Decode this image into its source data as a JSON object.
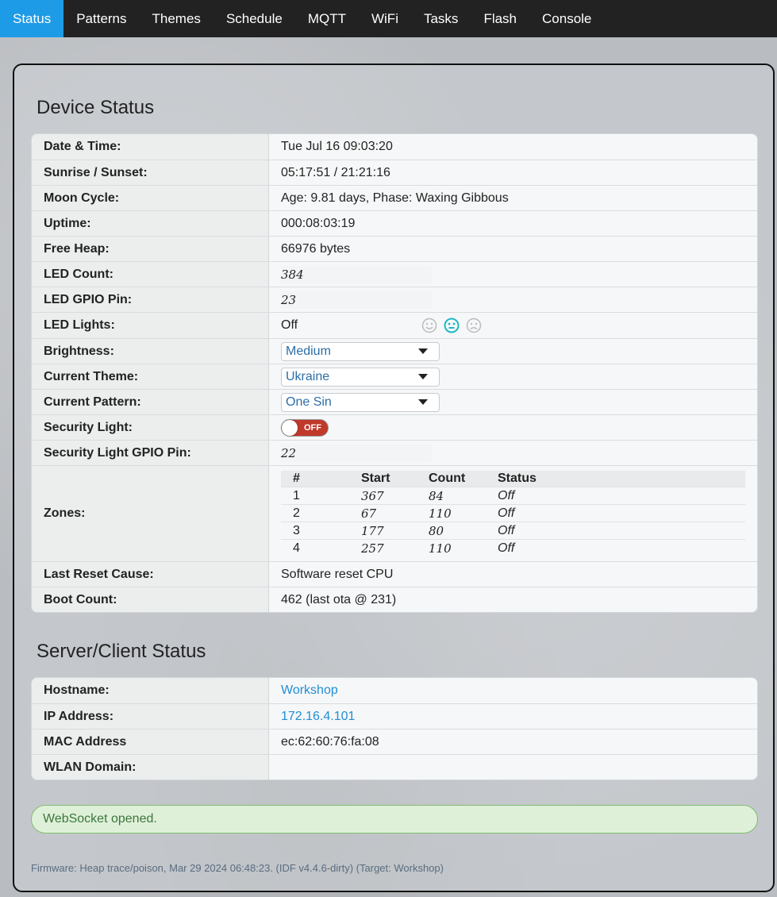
{
  "nav": {
    "tabs": [
      "Status",
      "Patterns",
      "Themes",
      "Schedule",
      "MQTT",
      "WiFi",
      "Tasks",
      "Flash",
      "Console"
    ],
    "active": "Status"
  },
  "device_status": {
    "title": "Device Status",
    "date_time": {
      "label": "Date & Time:",
      "value": "Tue Jul 16 09:03:20"
    },
    "sunrise_sunset": {
      "label": "Sunrise / Sunset:",
      "value": "05:17:51 / 21:21:16"
    },
    "moon_cycle": {
      "label": "Moon Cycle:",
      "value": "Age: 9.81 days, Phase: Waxing Gibbous"
    },
    "uptime": {
      "label": "Uptime:",
      "value": "000:08:03:19"
    },
    "free_heap": {
      "label": "Free Heap:",
      "value": "66976 bytes"
    },
    "led_count": {
      "label": "LED Count:",
      "value": "384"
    },
    "led_gpio_pin": {
      "label": "LED GPIO Pin:",
      "value": "23"
    },
    "led_lights": {
      "label": "LED Lights:",
      "value": "Off",
      "icons": [
        "smile-icon",
        "neutral-face-icon",
        "frown-icon"
      ],
      "selected_icon": "neutral-face-icon"
    },
    "brightness": {
      "label": "Brightness:",
      "value": "Medium"
    },
    "current_theme": {
      "label": "Current Theme:",
      "value": "Ukraine"
    },
    "current_pattern": {
      "label": "Current Pattern:",
      "value": "One Sin"
    },
    "security_light": {
      "label": "Security Light:",
      "toggle_text": "OFF",
      "on": false
    },
    "security_light_gpio_pin": {
      "label": "Security Light GPIO Pin:",
      "value": "22"
    },
    "zones": {
      "label": "Zones:",
      "headers": [
        "#",
        "Start",
        "Count",
        "Status"
      ],
      "rows": [
        {
          "id": "1",
          "start": "367",
          "count": "84",
          "status": "Off"
        },
        {
          "id": "2",
          "start": "67",
          "count": "110",
          "status": "Off"
        },
        {
          "id": "3",
          "start": "177",
          "count": "80",
          "status": "Off"
        },
        {
          "id": "4",
          "start": "257",
          "count": "110",
          "status": "Off"
        }
      ]
    },
    "last_reset_cause": {
      "label": "Last Reset Cause:",
      "value": "Software reset CPU"
    },
    "boot_count": {
      "label": "Boot Count:",
      "value": "462 (last ota @ 231)"
    }
  },
  "server_status": {
    "title": "Server/Client Status",
    "hostname": {
      "label": "Hostname:",
      "value": "Workshop"
    },
    "ip_address": {
      "label": "IP Address:",
      "value": "172.16.4.101"
    },
    "mac_address": {
      "label": "MAC Address",
      "value": "ec:62:60:76:fa:08"
    },
    "wlan_domain": {
      "label": "WLAN Domain:",
      "value": ""
    }
  },
  "alert": {
    "message": "WebSocket opened."
  },
  "footer": {
    "firmware": "Firmware: Heap trace/poison, Mar 29 2024 06:48:23. (IDF v4.4.6-dirty) (Target: Workshop)"
  },
  "colors": {
    "nav_bg": "#222222",
    "active_tab": "#1e9be6",
    "link": "#1e8fd6",
    "toggle_off": "#c0392b",
    "alert_bg": "#dff0d8"
  }
}
